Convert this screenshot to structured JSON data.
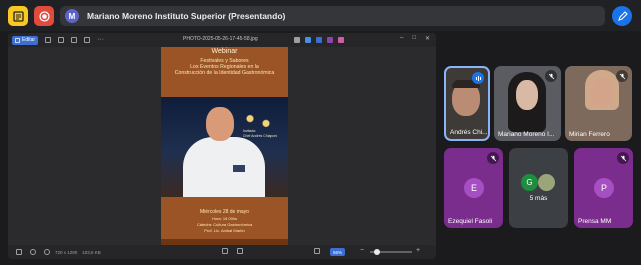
{
  "meeting": {
    "title": "Mariano Moreno Instituto Superior (Presentando)",
    "avatar_letter": "M",
    "colors": {
      "sticky_button": "#f9c923",
      "record_button": "#e24a3d",
      "edit_button": "#1a73e8",
      "title_avatar": "#5e63c9"
    }
  },
  "viewer": {
    "edit_label": "Editar",
    "file_name": "PHOTO-2025-05-26-17-45-58.jpg",
    "footer_size": "720 x 1280",
    "footer_filesize": "103,6 KB",
    "zoom_level": "56%",
    "accent": "#3c6fd1"
  },
  "poster": {
    "lines": [
      "Webinar",
      "Festivales y Sabores",
      "Los Eventos Regionales en la",
      "Construcción de la Identidad Gastronómica"
    ],
    "guest_label": "Invitado:",
    "guest_name": "Chef Andrés Chiaponi",
    "date_line": "Miércoles 28 de mayo",
    "time_line": "Hora: 19.00hs",
    "chair_line": "Cátedra: Cultura Gastronómica",
    "prof_line": "Prof. Lic. Aníbal Martín"
  },
  "participants": {
    "video_tiles": [
      {
        "name": "Andrés Chi...",
        "icon": "speaking-icon",
        "muted": false
      },
      {
        "name": "Mariano Moreno I...",
        "icon": "mic-off-icon",
        "muted": true
      },
      {
        "name": "Mirian Ferrero",
        "icon": "mic-off-icon",
        "muted": true
      }
    ],
    "avatar_tiles": [
      {
        "name": "Ezequiel Fasoli",
        "letter": "E",
        "bg": "#7b2d8e",
        "circle": "#a64fc2",
        "muted": true
      },
      {
        "name": "5 más",
        "letter": "G",
        "bg": "#3c3f44",
        "circle": "#1e8e3e",
        "muted": false
      },
      {
        "name": "Prensa MM",
        "letter": "P",
        "bg": "#7b2d8e",
        "circle": "#a64fc2",
        "muted": true
      }
    ]
  }
}
